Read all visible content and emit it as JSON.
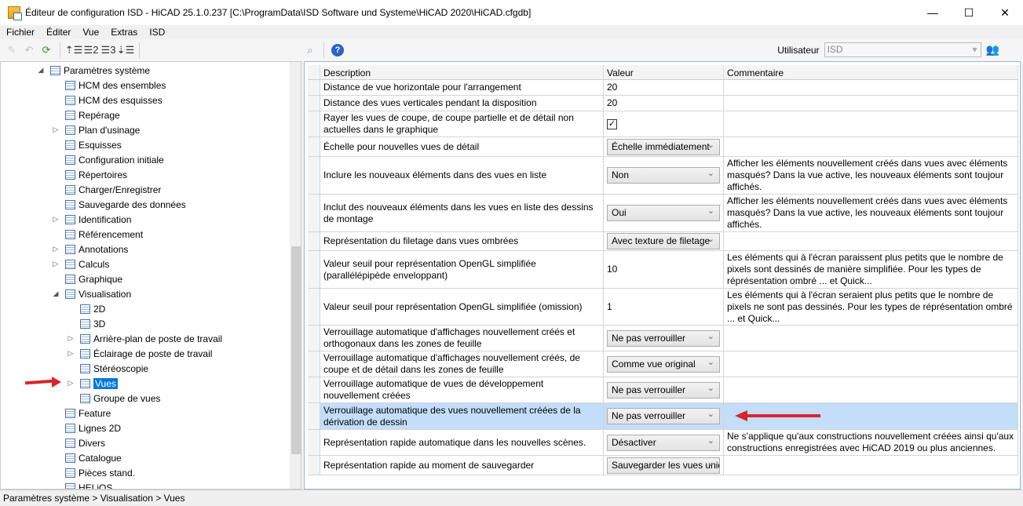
{
  "window": {
    "title": "Éditeur de configuration ISD  - HiCAD 25.1.0.237 [C:\\ProgramData\\ISD Software und Systeme\\HiCAD 2020\\HiCAD.cfgdb]"
  },
  "menu": [
    "Fichier",
    "Éditer",
    "Vue",
    "Extras",
    "ISD"
  ],
  "toolbar": {
    "user_label": "Utilisateur",
    "user_value": "ISD"
  },
  "tree": [
    {
      "label": "Paramètres système",
      "level": 0,
      "exp": "open"
    },
    {
      "label": "HCM des ensembles",
      "level": 1
    },
    {
      "label": "HCM des esquisses",
      "level": 1
    },
    {
      "label": "Repérage",
      "level": 1
    },
    {
      "label": "Plan d'usinage",
      "level": 1,
      "exp": "closed"
    },
    {
      "label": "Esquisses",
      "level": 1
    },
    {
      "label": "Configuration initiale",
      "level": 1
    },
    {
      "label": "Répertoires",
      "level": 1
    },
    {
      "label": "Charger/Enregistrer",
      "level": 1
    },
    {
      "label": "Sauvegarde des données",
      "level": 1
    },
    {
      "label": "Identification",
      "level": 1,
      "exp": "closed"
    },
    {
      "label": "Référencement",
      "level": 1
    },
    {
      "label": "Annotations",
      "level": 1,
      "exp": "closed"
    },
    {
      "label": "Calculs",
      "level": 1,
      "exp": "closed"
    },
    {
      "label": "Graphique",
      "level": 1
    },
    {
      "label": "Visualisation",
      "level": 1,
      "exp": "open"
    },
    {
      "label": "2D",
      "level": 2
    },
    {
      "label": "3D",
      "level": 2
    },
    {
      "label": "Arrière-plan de poste de travail",
      "level": 2,
      "exp": "closed"
    },
    {
      "label": "Éclairage de poste de travail",
      "level": 2,
      "exp": "closed"
    },
    {
      "label": "Stéréoscopie",
      "level": 2
    },
    {
      "label": "Vues",
      "level": 2,
      "exp": "closed",
      "selected": true
    },
    {
      "label": "Groupe de vues",
      "level": 2
    },
    {
      "label": "Feature",
      "level": 1
    },
    {
      "label": "Lignes 2D",
      "level": 1
    },
    {
      "label": "Divers",
      "level": 1
    },
    {
      "label": "Catalogue",
      "level": 1
    },
    {
      "label": "Pièces stand.",
      "level": 1
    },
    {
      "label": "HELiOS",
      "level": 1
    }
  ],
  "grid": {
    "columns": [
      "Description",
      "Valeur",
      "Commentaire"
    ],
    "rows": [
      {
        "d": "Distance de vue horizontale pour l'arrangement",
        "v": "20",
        "t": "text",
        "c": ""
      },
      {
        "d": "Distance des vues verticales pendant la disposition",
        "v": "20",
        "t": "text",
        "c": ""
      },
      {
        "d": "Rayer les vues de coupe, de coupe partielle et de détail non actuelles dans le graphique",
        "v": "✓",
        "t": "check",
        "c": ""
      },
      {
        "d": "Échelle pour nouvelles vues de détail",
        "v": "Échelle immédiatement",
        "t": "dd",
        "c": ""
      },
      {
        "d": "Inclure les nouveaux éléments dans des vues en liste",
        "v": "Non",
        "t": "dd",
        "c": "Afficher les éléments nouvellement créés dans vues avec éléments masqués? Dans la vue active, les nouveaux éléments sont toujour affichés."
      },
      {
        "d": "Inclut des nouveaux éléments dans les vues en liste des dessins de montage",
        "v": "Oui",
        "t": "dd",
        "c": "Afficher les éléments nouvellement créés dans vues avec éléments masqués? Dans la vue active, les nouveaux éléments sont toujour affichés."
      },
      {
        "d": "Représentation du filetage dans vues ombrées",
        "v": "Avec texture de filetage",
        "t": "dd",
        "c": ""
      },
      {
        "d": "Valeur seuil pour représentation OpenGL simplifiée (parallélépipède enveloppant)",
        "v": "10",
        "t": "text",
        "c": "Les éléments qui à l'écran paraissent plus petits que le nombre de pixels sont dessinés de manière simplifiée. Pour les types de réprésentation ombré ... et Quick..."
      },
      {
        "d": "Valeur seuil pour représentation OpenGL simplifiée (omission)",
        "v": "1",
        "t": "text",
        "c": "Les éléments qui à l'écran seraient plus petits que le nombre de pixels ne sont pas dessinés. Pour les types de réprésentation ombré ... et Quick..."
      },
      {
        "d": "Verrouillage automatique d'affichages nouvellement créés et orthogonaux dans les zones de feuille",
        "v": "Ne pas verrouiller",
        "t": "dd",
        "c": ""
      },
      {
        "d": "Verrouillage automatique d'affichages nouvellement créés, de coupe et de détail dans les zones de feuille",
        "v": "Comme vue original",
        "t": "dd",
        "c": ""
      },
      {
        "d": "Verrouillage automatique de vues de développement nouvellement créées",
        "v": "Ne pas verrouiller",
        "t": "dd",
        "c": ""
      },
      {
        "d": "Verrouillage automatique des vues nouvellement créées de la dérivation de dessin",
        "v": "Ne pas verrouiller",
        "t": "dd",
        "c": "",
        "selected": true
      },
      {
        "d": "Représentation rapide automatique dans les nouvelles scènes.",
        "v": "Désactiver",
        "t": "dd",
        "c": "Ne s'applique qu'aux constructions nouvellement créées ainsi qu'aux constructions enregistrées avec HiCAD 2019 ou plus anciennes."
      },
      {
        "d": "Représentation rapide au moment de sauvegarder",
        "v": "Sauvegarder les vues uniquement",
        "t": "dd",
        "c": ""
      }
    ]
  },
  "status": "Paramètres système > Visualisation > Vues",
  "colors": {
    "selection": "#0078d7",
    "row_selected": "#c4defa",
    "annotation_arrow": "#d9252a"
  }
}
